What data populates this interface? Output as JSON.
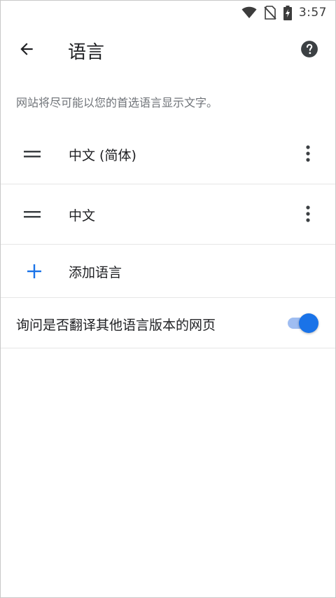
{
  "status_bar": {
    "time": "3:57",
    "icons": [
      "wifi-icon",
      "no-sim-icon",
      "battery-charging-icon"
    ]
  },
  "toolbar": {
    "back_icon": "arrow-back-icon",
    "title": "语言",
    "help_icon": "help-circle-icon"
  },
  "description": "网站将尽可能以您的首选语言显示文字。",
  "languages": [
    {
      "label": "中文 (简体)"
    },
    {
      "label": "中文"
    }
  ],
  "add_language": {
    "label": "添加语言",
    "icon": "plus-icon"
  },
  "translate_offer": {
    "label": "询问是否翻译其他语言版本的网页",
    "enabled": true
  },
  "colors": {
    "accent": "#1a73e8",
    "toggle_track": "#9fbdf1",
    "text_primary": "#202124",
    "text_secondary": "#6f7378",
    "divider": "#e6e6e6"
  }
}
